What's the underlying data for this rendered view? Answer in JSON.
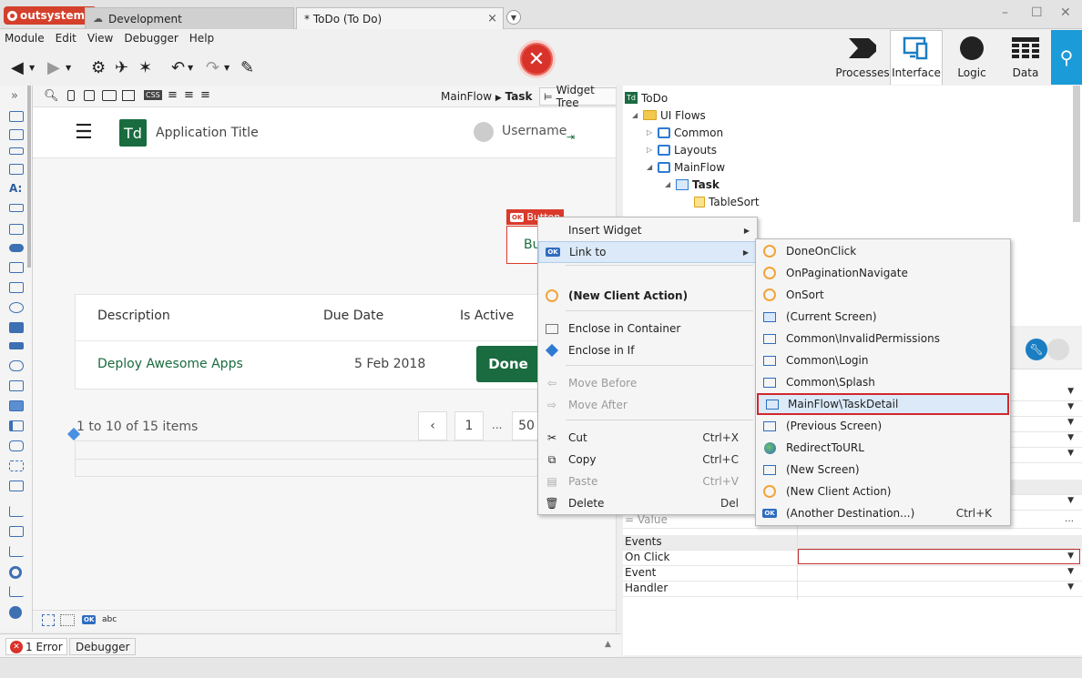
{
  "tabs": {
    "brand": "outsystems",
    "env": "Development",
    "doc": "* ToDo (To Do)"
  },
  "menu": [
    "Module",
    "Edit",
    "View",
    "Debugger",
    "Help"
  ],
  "nav": {
    "processes": "Processes",
    "interface": "Interface",
    "logic": "Logic",
    "data": "Data"
  },
  "canvas": {
    "breadcrumb_flow": "MainFlow",
    "breadcrumb_screen": "Task",
    "widget_tree": "Widget Tree",
    "app_badge": "Td",
    "app_title": "Application Title",
    "username": "Username",
    "button_tag": "Button",
    "button_partial": "Bu",
    "table": {
      "headers": [
        "Description",
        "Due Date",
        "Is Active"
      ],
      "row": {
        "description": "Deploy Awesome Apps",
        "due": "5 Feb 2018",
        "action": "Done"
      }
    },
    "pager_info": "1 to 10 of 15 items",
    "pager": {
      "prev": "‹",
      "page1": "1",
      "ellipsis": "...",
      "last": "50"
    },
    "widgetbar_text": "abc"
  },
  "tree": {
    "root_badge": "Td",
    "root": "ToDo",
    "ui_flows": "UI Flows",
    "common": "Common",
    "layouts": "Layouts",
    "mainflow": "MainFlow",
    "task": "Task",
    "tablesort": "TableSort"
  },
  "props": {
    "value_label": "= Value",
    "events_header": "Events",
    "on_click": "On Click",
    "event": "Event",
    "handler": "Handler"
  },
  "status": {
    "errors": "1 Error",
    "debugger": "Debugger"
  },
  "context_menu": {
    "insert_widget": "Insert Widget",
    "link_to": "Link to",
    "new_client_action": "(New  Client Action)",
    "enclose_container": "Enclose in Container",
    "enclose_if": "Enclose in If",
    "move_before": "Move Before",
    "move_after": "Move After",
    "cut": "Cut",
    "cut_key": "Ctrl+X",
    "copy": "Copy",
    "copy_key": "Ctrl+C",
    "paste": "Paste",
    "paste_key": "Ctrl+V",
    "delete": "Delete",
    "delete_key": "Del"
  },
  "submenu": {
    "items": [
      "DoneOnClick",
      "OnPaginationNavigate",
      "OnSort",
      "(Current Screen)",
      "Common\\InvalidPermissions",
      "Common\\Login",
      "Common\\Splash",
      "MainFlow\\TaskDetail",
      "(Previous Screen)",
      "RedirectToURL",
      "(New Screen)",
      "(New Client Action)",
      "(Another Destination...)"
    ],
    "another_key": "Ctrl+K"
  },
  "colors": {
    "brand_green": "#1a6b3f",
    "accent_blue": "#1b9bd7",
    "error_red": "#d9322a",
    "highlight_border": "#d2272c"
  }
}
